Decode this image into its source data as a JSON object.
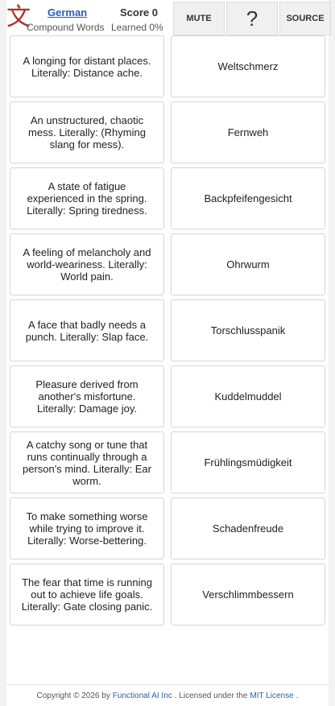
{
  "header": {
    "logo_glyph": "文",
    "language": "German",
    "subtitle": "Compound Words",
    "score_label": "Score 0",
    "learned_label": "Learned 0%",
    "mute_label": "MUTE",
    "help_label": "?",
    "source_label": "SOURCE"
  },
  "definitions": [
    "A longing for distant places. Literally: Distance ache.",
    "An unstructured, chaotic mess. Literally: (Rhyming slang for mess).",
    "A state of fatigue experienced in the spring. Literally: Spring tiredness.",
    "A feeling of melancholy and world-weariness. Literally: World pain.",
    "A face that badly needs a punch. Literally: Slap face.",
    "Pleasure derived from another's misfortune. Literally: Damage joy.",
    "A catchy song or tune that runs continually through a person's mind. Literally: Ear worm.",
    "To make something worse while trying to improve it. Literally: Worse-bettering.",
    "The fear that time is running out to achieve life goals. Literally: Gate closing panic."
  ],
  "words": [
    "Weltschmerz",
    "Fernweh",
    "Backpfeifengesicht",
    "Ohrwurm",
    "Torschlusspanik",
    "Kuddelmuddel",
    "Frühlingsmüdigkeit",
    "Schadenfreude",
    "Verschlimmbessern"
  ],
  "footer": {
    "copyright": "Copyright © 2026 by",
    "company": "Functional AI Inc",
    "licensed": ". Licensed under the",
    "license": "MIT License",
    "end": "."
  }
}
